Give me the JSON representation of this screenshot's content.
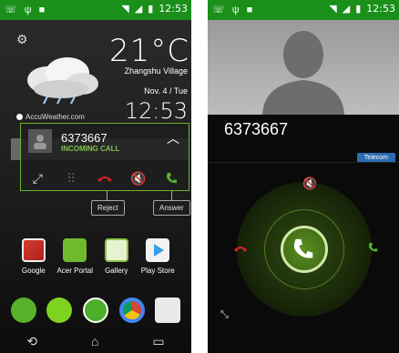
{
  "left": {
    "status_bar": {
      "time": "12:53"
    },
    "weather": {
      "temperature": "21°C",
      "location": "Zhangshu Village",
      "date": "Nov. 4 / Tue",
      "clock": "12:53",
      "provider": "AccuWeather.com"
    },
    "incoming_call": {
      "number": "6373667",
      "label": "INCOMING CALL"
    },
    "tooltips": {
      "reject": "Reject",
      "answer": "Answer"
    },
    "apps": [
      {
        "label": "Google"
      },
      {
        "label": "Acer Portal"
      },
      {
        "label": "Gallery"
      },
      {
        "label": "Play Store"
      }
    ]
  },
  "right": {
    "status_bar": {
      "time": "12:53"
    },
    "caller_number": "6373667",
    "carrier": "Telecom"
  },
  "colors": {
    "status_green": "#1a8f1a",
    "accent_green": "#5ab22a",
    "reject_red": "#d92020",
    "carrier_blue": "#2b6db0"
  }
}
